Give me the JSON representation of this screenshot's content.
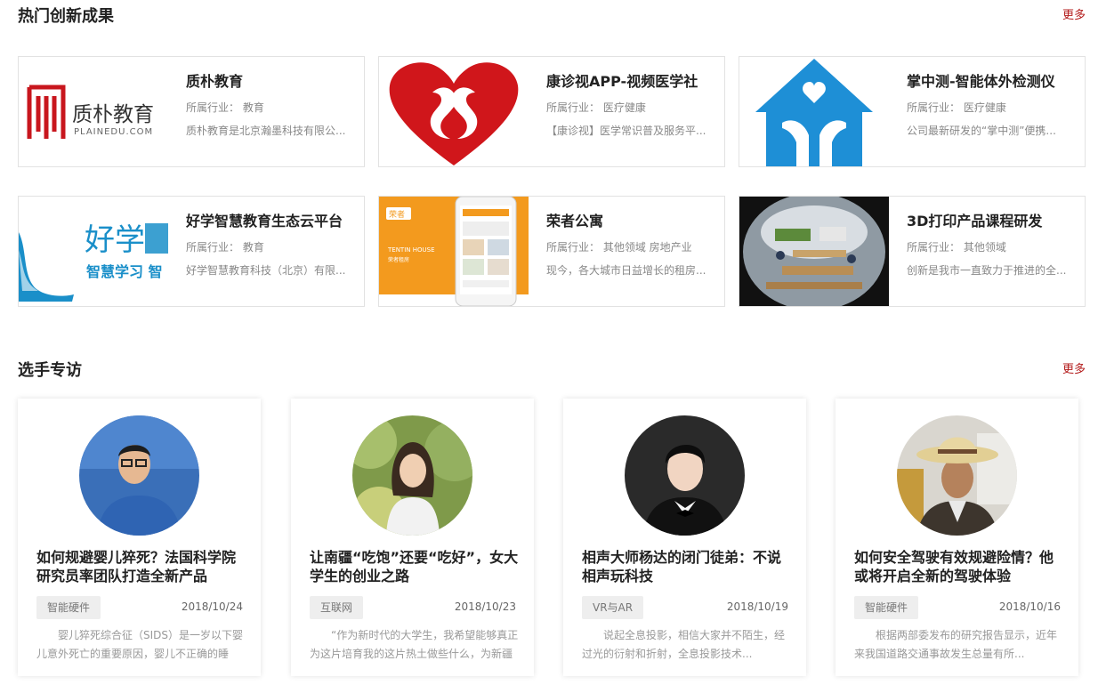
{
  "innovation": {
    "title": "热门创新成果",
    "more": "更多",
    "items": [
      {
        "title": "质朴教育",
        "industry": "所属行业： 教育",
        "desc": "质朴教育是北京瀚墨科技有限公...",
        "logo_cn": "质朴教育",
        "logo_en": "PLAINEDU.COM"
      },
      {
        "title": "康诊视APP-视频医学社",
        "industry": "所属行业： 医疗健康",
        "desc": "【康诊视】医学常识普及服务平..."
      },
      {
        "title": "掌中测-智能体外检测仪",
        "industry": "所属行业： 医疗健康",
        "desc": "公司最新研发的“掌中测”便携..."
      },
      {
        "title": "好学智慧教育生态云平台",
        "industry": "所属行业： 教育",
        "desc": "好学智慧教育科技（北京）有限...",
        "logo_cn": "好学",
        "logo_sub": "智慧学习 智"
      },
      {
        "title": "荣者公寓",
        "industry": "所属行业： 其他领域 房地产业",
        "desc": "现今，各大城市日益增长的租房...",
        "logo_cn": "荣者",
        "logo_en": "TENTIN HOUSE",
        "logo_sub": "荣者租房"
      },
      {
        "title": "3D打印产品课程研发",
        "industry": "所属行业： 其他领域",
        "desc": "创新是我市一直致力于推进的全..."
      }
    ]
  },
  "interviews": {
    "title": "选手专访",
    "more": "更多",
    "items": [
      {
        "title": "如何规避婴儿猝死？法国科学院研究员率团队打造全新产品",
        "tag": "智能硬件",
        "date": "2018/10/24",
        "desc": "婴儿猝死综合征（SIDS）是一岁以下婴儿意外死亡的重要原因，婴儿不正确的睡"
      },
      {
        "title": "让南疆“吃饱”还要“吃好”，女大学生的创业之路",
        "tag": "互联网",
        "date": "2018/10/23",
        "desc": "“作为新时代的大学生，我希望能够真正为这片培育我的这片热土做些什么，为新疆"
      },
      {
        "title": "相声大师杨达的闭门徒弟：不说相声玩科技",
        "tag": "VR与AR",
        "date": "2018/10/19",
        "desc": "说起全息投影，相信大家并不陌生，经过光的衍射和折射，全息投影技术..."
      },
      {
        "title": "如何安全驾驶有效规避险情？他或将开启全新的驾驶体验",
        "tag": "智能硬件",
        "date": "2018/10/16",
        "desc": "根据两部委发布的研究报告显示，近年来我国道路交通事故发生总量有所..."
      }
    ]
  },
  "colors": {
    "accent": "#b31b1b",
    "heart_red": "#d0161b",
    "house_blue": "#1e8fd6",
    "haoxue_blue": "#1a8fc9",
    "rongzhe_orange": "#f39a1e"
  }
}
